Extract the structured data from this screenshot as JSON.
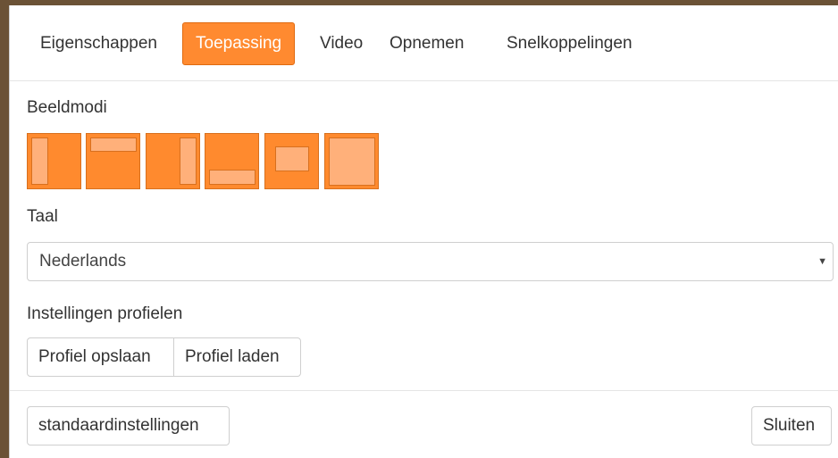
{
  "tabs": [
    {
      "label": "Eigenschappen"
    },
    {
      "label": "Toepassing",
      "active": true
    },
    {
      "label": "Video"
    },
    {
      "label": "Opnemen"
    },
    {
      "label": "Snelkoppelingen"
    }
  ],
  "accent_color": "#ff8a30",
  "display_modes": {
    "label": "Beeldmodi",
    "icons": [
      "layout-left-icon",
      "layout-top-icon",
      "layout-right-icon",
      "layout-bottom-icon",
      "layout-center-icon",
      "layout-full-icon"
    ]
  },
  "language": {
    "label": "Taal",
    "selected": "Nederlands",
    "arrow_glyph": "▼"
  },
  "profiles": {
    "label": "Instellingen profielen",
    "save_label": "Profiel opslaan",
    "load_label": "Profiel laden"
  },
  "footer": {
    "defaults_label": "standaardinstellingen",
    "close_label": "Sluiten"
  }
}
